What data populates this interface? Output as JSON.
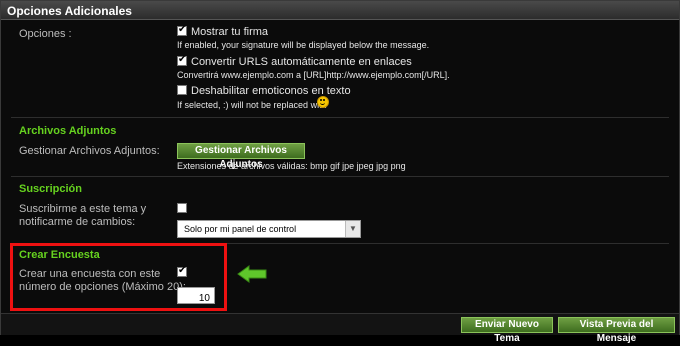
{
  "header": {
    "title": "Opciones Adicionales"
  },
  "options": {
    "label": "Opciones :",
    "items": [
      {
        "label": "Mostrar tu firma",
        "checked": true,
        "desc": "If enabled, your signature will be displayed below the message."
      },
      {
        "label": "Convertir URLS automáticamente en enlaces",
        "checked": true,
        "desc": "Convertirá www.ejemplo.com a [URL]http://www.ejemplo.com[/URL]."
      },
      {
        "label": "Deshabilitar emoticonos en texto",
        "checked": false,
        "desc": "If selected, :) will not be replaced with"
      }
    ]
  },
  "attachments": {
    "title": "Archivos Adjuntos",
    "label": "Gestionar Archivos Adjuntos:",
    "button": "Gestionar Archivos Adjuntos",
    "extensions": "Extensiones de archivos válidas: bmp gif jpe jpeg jpg png"
  },
  "subscription": {
    "title": "Suscripción",
    "label_line1": "Suscribirme a este tema y",
    "label_line2": "notificarme de cambios:",
    "checked": false,
    "select_value": "Solo por mi panel de control"
  },
  "poll": {
    "title": "Crear Encuesta",
    "label_line1": "Crear una encuesta con este",
    "label_line2": "número de opciones (Máximo 20):",
    "checked": true,
    "count": "10"
  },
  "footer": {
    "submit": "Enviar Nuevo Tema",
    "preview": "Vista Previa del Mensaje"
  },
  "icons": {
    "smiley": "smiley-emoticon-icon",
    "arrow": "arrow-left-icon"
  },
  "colors": {
    "accent_green": "#66d21f",
    "highlight_red": "#e11111",
    "button_green": "#4f7f2b"
  }
}
